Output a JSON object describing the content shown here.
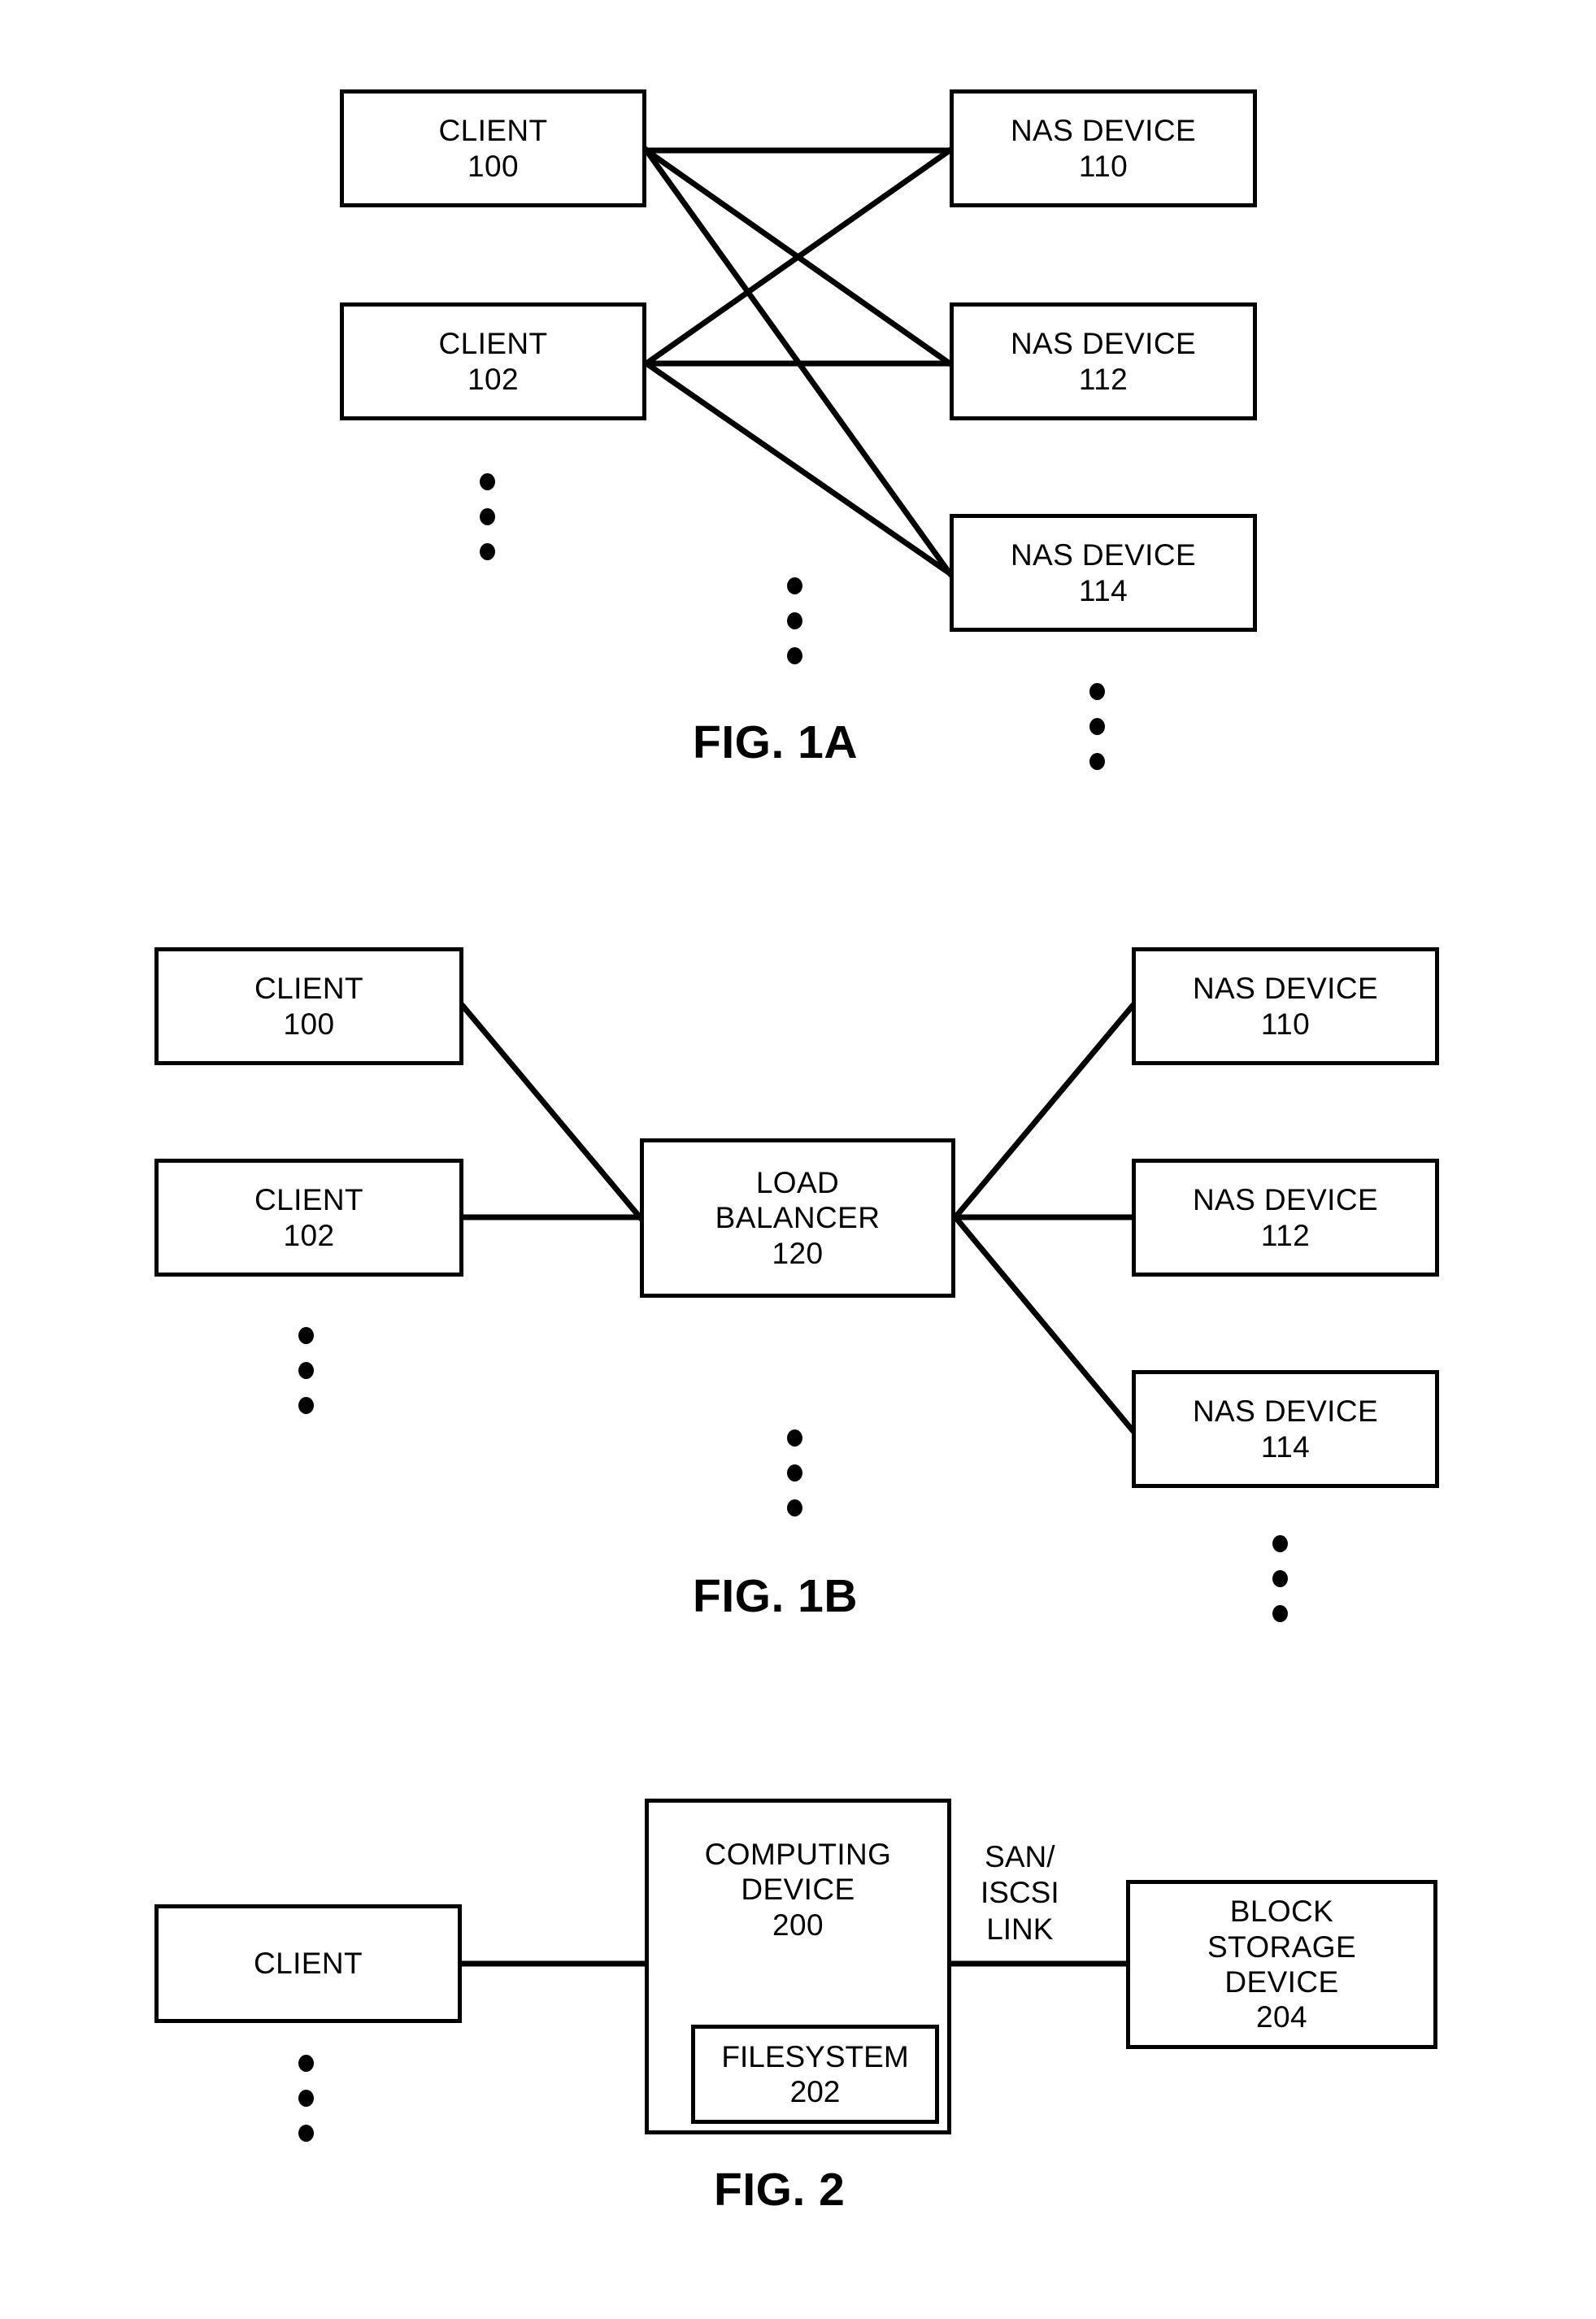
{
  "document": {
    "type": "patent-figure-sheet",
    "background_color": "#FFFFFF",
    "line_color": "#000000"
  },
  "figures": [
    {
      "id": "fig-1a",
      "caption": "FIG. 1A",
      "nodes": [
        {
          "id": "client-100",
          "line1": "CLIENT",
          "line2": "100"
        },
        {
          "id": "client-102",
          "line1": "CLIENT",
          "line2": "102"
        },
        {
          "id": "nas-110",
          "line1": "NAS DEVICE",
          "line2": "110"
        },
        {
          "id": "nas-112",
          "line1": "NAS DEVICE",
          "line2": "112"
        },
        {
          "id": "nas-114",
          "line1": "NAS DEVICE",
          "line2": "114"
        }
      ],
      "connections": [
        {
          "from": "client-100",
          "to": "nas-110"
        },
        {
          "from": "client-100",
          "to": "nas-112"
        },
        {
          "from": "client-100",
          "to": "nas-114"
        },
        {
          "from": "client-102",
          "to": "nas-110"
        },
        {
          "from": "client-102",
          "to": "nas-112"
        },
        {
          "from": "client-102",
          "to": "nas-114"
        }
      ],
      "ellipses": [
        {
          "id": "clients-more",
          "dots": 3
        },
        {
          "id": "nas-more-mid",
          "dots": 3
        },
        {
          "id": "nas-more-bottom",
          "dots": 3
        }
      ]
    },
    {
      "id": "fig-1b",
      "caption": "FIG. 1B",
      "nodes": [
        {
          "id": "client-100",
          "line1": "CLIENT",
          "line2": "100"
        },
        {
          "id": "client-102",
          "line1": "CLIENT",
          "line2": "102"
        },
        {
          "id": "load-balancer-120",
          "line1": "LOAD",
          "line2": "BALANCER",
          "line3": "120"
        },
        {
          "id": "nas-110",
          "line1": "NAS DEVICE",
          "line2": "110"
        },
        {
          "id": "nas-112",
          "line1": "NAS DEVICE",
          "line2": "112"
        },
        {
          "id": "nas-114",
          "line1": "NAS DEVICE",
          "line2": "114"
        }
      ],
      "connections": [
        {
          "from": "client-100",
          "to": "load-balancer-120"
        },
        {
          "from": "client-102",
          "to": "load-balancer-120"
        },
        {
          "from": "load-balancer-120",
          "to": "nas-110"
        },
        {
          "from": "load-balancer-120",
          "to": "nas-112"
        },
        {
          "from": "load-balancer-120",
          "to": "nas-114"
        }
      ],
      "ellipses": [
        {
          "id": "clients-more",
          "dots": 3
        },
        {
          "id": "center-more",
          "dots": 3
        },
        {
          "id": "nas-more",
          "dots": 3
        }
      ]
    },
    {
      "id": "fig-2",
      "caption": "FIG. 2",
      "nodes": [
        {
          "id": "client",
          "line1": "CLIENT"
        },
        {
          "id": "computing-device-200",
          "line1": "COMPUTING",
          "line2": "DEVICE",
          "line3": "200"
        },
        {
          "id": "filesystem-202",
          "line1": "FILESYSTEM",
          "line2": "202"
        },
        {
          "id": "block-storage-204",
          "line1": "BLOCK",
          "line2": "STORAGE",
          "line3": "DEVICE",
          "line4": "204"
        }
      ],
      "link_label": {
        "line1": "SAN/",
        "line2": "ISCSI",
        "line3": "LINK"
      },
      "connections": [
        {
          "from": "client",
          "to": "computing-device-200"
        },
        {
          "from": "computing-device-200",
          "to": "block-storage-204",
          "label": "SAN/ ISCSI LINK"
        }
      ],
      "ellipses": [
        {
          "id": "clients-more",
          "dots": 3
        }
      ]
    }
  ]
}
